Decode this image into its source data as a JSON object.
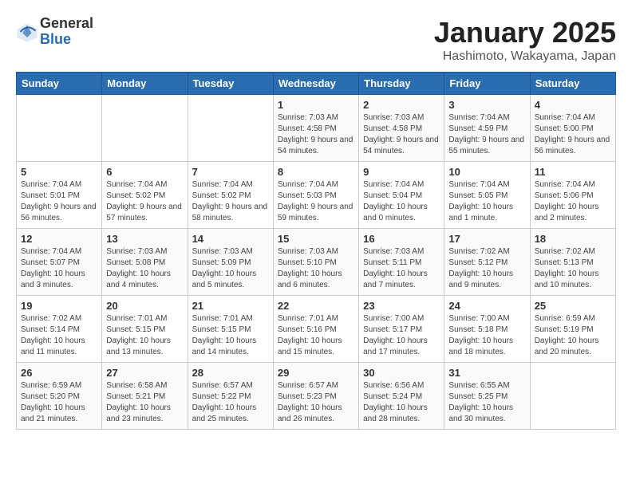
{
  "header": {
    "logo_line1": "General",
    "logo_line2": "Blue",
    "title": "January 2025",
    "subtitle": "Hashimoto, Wakayama, Japan"
  },
  "weekdays": [
    "Sunday",
    "Monday",
    "Tuesday",
    "Wednesday",
    "Thursday",
    "Friday",
    "Saturday"
  ],
  "weeks": [
    [
      {
        "day": "",
        "info": ""
      },
      {
        "day": "",
        "info": ""
      },
      {
        "day": "",
        "info": ""
      },
      {
        "day": "1",
        "info": "Sunrise: 7:03 AM\nSunset: 4:58 PM\nDaylight: 9 hours and 54 minutes."
      },
      {
        "day": "2",
        "info": "Sunrise: 7:03 AM\nSunset: 4:58 PM\nDaylight: 9 hours and 54 minutes."
      },
      {
        "day": "3",
        "info": "Sunrise: 7:04 AM\nSunset: 4:59 PM\nDaylight: 9 hours and 55 minutes."
      },
      {
        "day": "4",
        "info": "Sunrise: 7:04 AM\nSunset: 5:00 PM\nDaylight: 9 hours and 56 minutes."
      }
    ],
    [
      {
        "day": "5",
        "info": "Sunrise: 7:04 AM\nSunset: 5:01 PM\nDaylight: 9 hours and 56 minutes."
      },
      {
        "day": "6",
        "info": "Sunrise: 7:04 AM\nSunset: 5:02 PM\nDaylight: 9 hours and 57 minutes."
      },
      {
        "day": "7",
        "info": "Sunrise: 7:04 AM\nSunset: 5:02 PM\nDaylight: 9 hours and 58 minutes."
      },
      {
        "day": "8",
        "info": "Sunrise: 7:04 AM\nSunset: 5:03 PM\nDaylight: 9 hours and 59 minutes."
      },
      {
        "day": "9",
        "info": "Sunrise: 7:04 AM\nSunset: 5:04 PM\nDaylight: 10 hours and 0 minutes."
      },
      {
        "day": "10",
        "info": "Sunrise: 7:04 AM\nSunset: 5:05 PM\nDaylight: 10 hours and 1 minute."
      },
      {
        "day": "11",
        "info": "Sunrise: 7:04 AM\nSunset: 5:06 PM\nDaylight: 10 hours and 2 minutes."
      }
    ],
    [
      {
        "day": "12",
        "info": "Sunrise: 7:04 AM\nSunset: 5:07 PM\nDaylight: 10 hours and 3 minutes."
      },
      {
        "day": "13",
        "info": "Sunrise: 7:03 AM\nSunset: 5:08 PM\nDaylight: 10 hours and 4 minutes."
      },
      {
        "day": "14",
        "info": "Sunrise: 7:03 AM\nSunset: 5:09 PM\nDaylight: 10 hours and 5 minutes."
      },
      {
        "day": "15",
        "info": "Sunrise: 7:03 AM\nSunset: 5:10 PM\nDaylight: 10 hours and 6 minutes."
      },
      {
        "day": "16",
        "info": "Sunrise: 7:03 AM\nSunset: 5:11 PM\nDaylight: 10 hours and 7 minutes."
      },
      {
        "day": "17",
        "info": "Sunrise: 7:02 AM\nSunset: 5:12 PM\nDaylight: 10 hours and 9 minutes."
      },
      {
        "day": "18",
        "info": "Sunrise: 7:02 AM\nSunset: 5:13 PM\nDaylight: 10 hours and 10 minutes."
      }
    ],
    [
      {
        "day": "19",
        "info": "Sunrise: 7:02 AM\nSunset: 5:14 PM\nDaylight: 10 hours and 11 minutes."
      },
      {
        "day": "20",
        "info": "Sunrise: 7:01 AM\nSunset: 5:15 PM\nDaylight: 10 hours and 13 minutes."
      },
      {
        "day": "21",
        "info": "Sunrise: 7:01 AM\nSunset: 5:15 PM\nDaylight: 10 hours and 14 minutes."
      },
      {
        "day": "22",
        "info": "Sunrise: 7:01 AM\nSunset: 5:16 PM\nDaylight: 10 hours and 15 minutes."
      },
      {
        "day": "23",
        "info": "Sunrise: 7:00 AM\nSunset: 5:17 PM\nDaylight: 10 hours and 17 minutes."
      },
      {
        "day": "24",
        "info": "Sunrise: 7:00 AM\nSunset: 5:18 PM\nDaylight: 10 hours and 18 minutes."
      },
      {
        "day": "25",
        "info": "Sunrise: 6:59 AM\nSunset: 5:19 PM\nDaylight: 10 hours and 20 minutes."
      }
    ],
    [
      {
        "day": "26",
        "info": "Sunrise: 6:59 AM\nSunset: 5:20 PM\nDaylight: 10 hours and 21 minutes."
      },
      {
        "day": "27",
        "info": "Sunrise: 6:58 AM\nSunset: 5:21 PM\nDaylight: 10 hours and 23 minutes."
      },
      {
        "day": "28",
        "info": "Sunrise: 6:57 AM\nSunset: 5:22 PM\nDaylight: 10 hours and 25 minutes."
      },
      {
        "day": "29",
        "info": "Sunrise: 6:57 AM\nSunset: 5:23 PM\nDaylight: 10 hours and 26 minutes."
      },
      {
        "day": "30",
        "info": "Sunrise: 6:56 AM\nSunset: 5:24 PM\nDaylight: 10 hours and 28 minutes."
      },
      {
        "day": "31",
        "info": "Sunrise: 6:55 AM\nSunset: 5:25 PM\nDaylight: 10 hours and 30 minutes."
      },
      {
        "day": "",
        "info": ""
      }
    ]
  ]
}
